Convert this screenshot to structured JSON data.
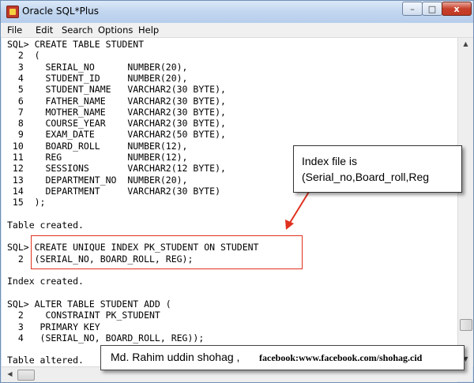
{
  "window": {
    "title": "Oracle SQL*Plus"
  },
  "titlebar_buttons": {
    "minimize": "–",
    "maximize": "□",
    "close": "x"
  },
  "menu": [
    "File",
    "Edit",
    "Search",
    "Options",
    "Help"
  ],
  "console_lines": [
    "SQL> CREATE TABLE STUDENT",
    "  2  (",
    "  3    SERIAL_NO      NUMBER(20),",
    "  4    STUDENT_ID     NUMBER(20),",
    "  5    STUDENT_NAME   VARCHAR2(30 BYTE),",
    "  6    FATHER_NAME    VARCHAR2(30 BYTE),",
    "  7    MOTHER_NAME    VARCHAR2(30 BYTE),",
    "  8    COURSE_YEAR    VARCHAR2(30 BYTE),",
    "  9    EXAM_DATE      VARCHAR2(50 BYTE),",
    " 10    BOARD_ROLL     NUMBER(12),",
    " 11    REG            NUMBER(12),",
    " 12    SESSIONS       VARCHAR2(12 BYTE),",
    " 13    DEPARTMENT_NO  NUMBER(20),",
    " 14    DEPARTMENT     VARCHAR2(30 BYTE)",
    " 15  );",
    "",
    "Table created.",
    "",
    "SQL> CREATE UNIQUE INDEX PK_STUDENT ON STUDENT",
    "  2  (SERIAL_NO, BOARD_ROLL, REG);",
    "",
    "Index created.",
    "",
    "SQL> ALTER TABLE STUDENT ADD (",
    "  2    CONSTRAINT PK_STUDENT",
    "  3   PRIMARY KEY",
    "  4   (SERIAL_NO, BOARD_ROLL, REG));",
    "",
    "Table altered."
  ],
  "callout": {
    "line1": "Index file is",
    "line2": "(Serial_no,Board_roll,Reg"
  },
  "credit": {
    "name": "Md. Rahim uddin shohag ,",
    "facebook": "facebook:www.facebook.com/shohag.cid"
  },
  "colors": {
    "highlight_box": "#e0311f",
    "arrow": "#e0311f",
    "titlebar": "#c2d6ef"
  }
}
